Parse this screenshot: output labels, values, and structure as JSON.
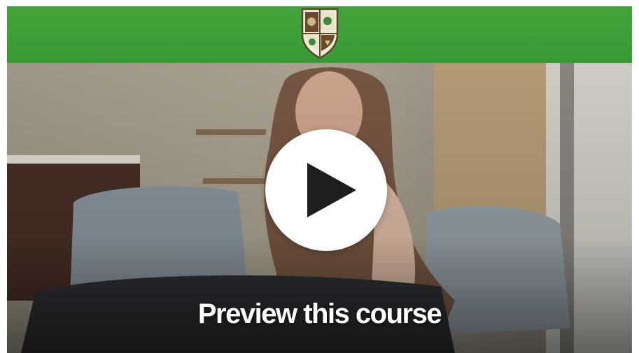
{
  "header": {
    "logo_icon": "crest-shield-icon",
    "background_color": "#3da237"
  },
  "video": {
    "play_icon": "play-icon",
    "preview_label": "Preview this course"
  }
}
